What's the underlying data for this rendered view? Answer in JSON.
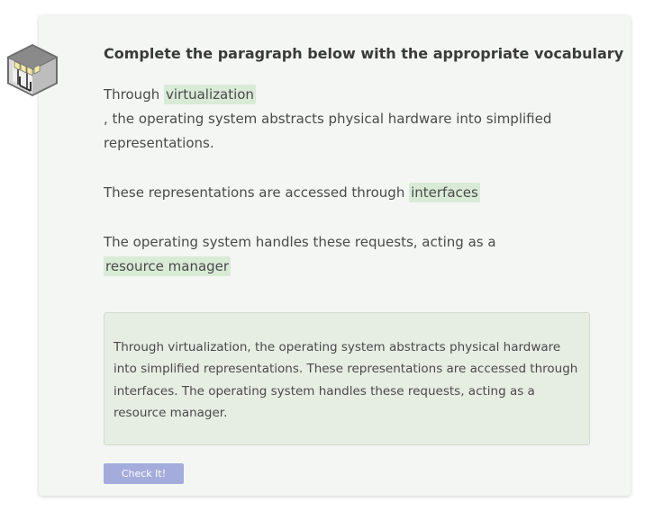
{
  "exercise": {
    "instruction": "Complete the paragraph below with the appropriate vocabulary",
    "para1_before": "Through ",
    "blank1": "virtualization",
    "para1_after_line1": ", the operating system abstracts physical hardware into simplified",
    "para1_after_line2": "representations.",
    "para2_before": "These representations are accessed through ",
    "blank2": "interfaces",
    "para3_before": "The operating system handles these requests, acting as a",
    "blank3": "resource manager",
    "answer_text": "Through virtualization, the operating system abstracts physical hardware into simplified representations. These representations are accessed through interfaces. The operating system handles these requests, acting as a resource manager.",
    "check_button_label": "Check It!"
  },
  "icons": {
    "exercise_icon": "bookshelf-cube-icon"
  },
  "colors": {
    "card_background": "#f4f6f3",
    "blank_highlight": "#d9ebd7",
    "answer_box": "#e6ede3",
    "check_button": "#a4acdc"
  }
}
